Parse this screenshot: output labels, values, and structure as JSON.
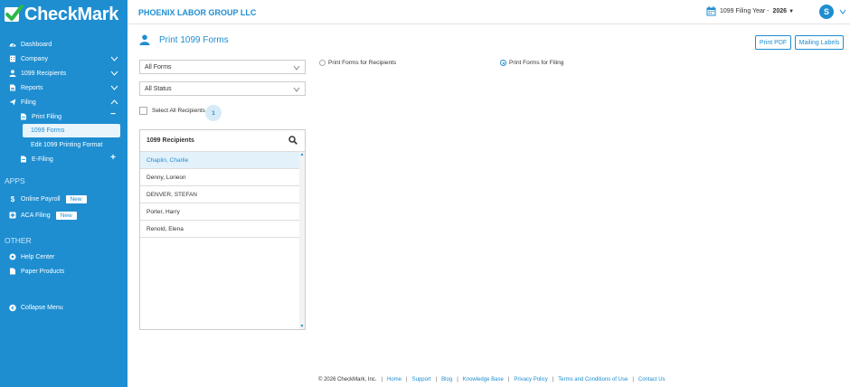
{
  "brand": {
    "name": "CheckMark"
  },
  "colors": {
    "accent": "#1e8ed1",
    "sidebar": "#1e8ed1",
    "selected_row": "#e3f1fb"
  },
  "sidebar": {
    "items": [
      {
        "label": "Dashboard",
        "icon": "dashboard-icon"
      },
      {
        "label": "Company",
        "icon": "company-icon",
        "chevron": "down"
      },
      {
        "label": "1099 Recipients",
        "icon": "user-icon",
        "chevron": "down"
      },
      {
        "label": "Reports",
        "icon": "reports-icon",
        "chevron": "down"
      },
      {
        "label": "Filing",
        "icon": "send-icon",
        "chevron": "up"
      }
    ],
    "print_filing": {
      "label": "Print Filing",
      "toggle": "−"
    },
    "forms_1099": "1099 Forms",
    "edit_format": "Edit 1099 Printing Format",
    "efiling": {
      "label": "E-Filing",
      "toggle": "+"
    },
    "apps_title": "APPS",
    "apps": [
      {
        "label": "Online Payroll",
        "badge": "New",
        "icon": "dollar-icon"
      },
      {
        "label": "ACA Filing",
        "badge": "New",
        "icon": "aca-icon"
      }
    ],
    "other_title": "OTHER",
    "other": [
      {
        "label": "Help Center",
        "icon": "help-icon"
      },
      {
        "label": "Paper Products",
        "icon": "document-icon"
      }
    ],
    "collapse": "Collapse Menu"
  },
  "header": {
    "company": "PHOENIX LABOR GROUP LLC",
    "filing_year_label": "1099 Filing Year -",
    "filing_year": "2026",
    "avatar_initial": "S"
  },
  "main": {
    "title": "Print 1099 Forms",
    "buttons": {
      "print_pdf": "Print PDF",
      "mailing_labels": "Mailing Labels"
    },
    "forms_select": "All Forms",
    "status_select": "All Status",
    "select_all": "Select All Recipients",
    "selected_count": "1",
    "radio_recipients": "Print Forms for Recipients",
    "radio_filing": "Print Forms for Filing",
    "radio_selected": "filing",
    "recipients_header": "1099 Recipients",
    "recipients": [
      "Chaplin, Charlie",
      "Denny, Lorieon",
      "DENVER, STEFAN",
      "Porter, Harry",
      "Renold, Elena"
    ],
    "selected_recipient": 0
  },
  "footer": {
    "copyright": "© 2026 CheckMark, Inc.",
    "links": [
      "Home",
      "Support",
      "Blog",
      "Knowledge Base",
      "Privacy Policy",
      "Terms and Conditions of Use",
      "Contact Us"
    ]
  }
}
